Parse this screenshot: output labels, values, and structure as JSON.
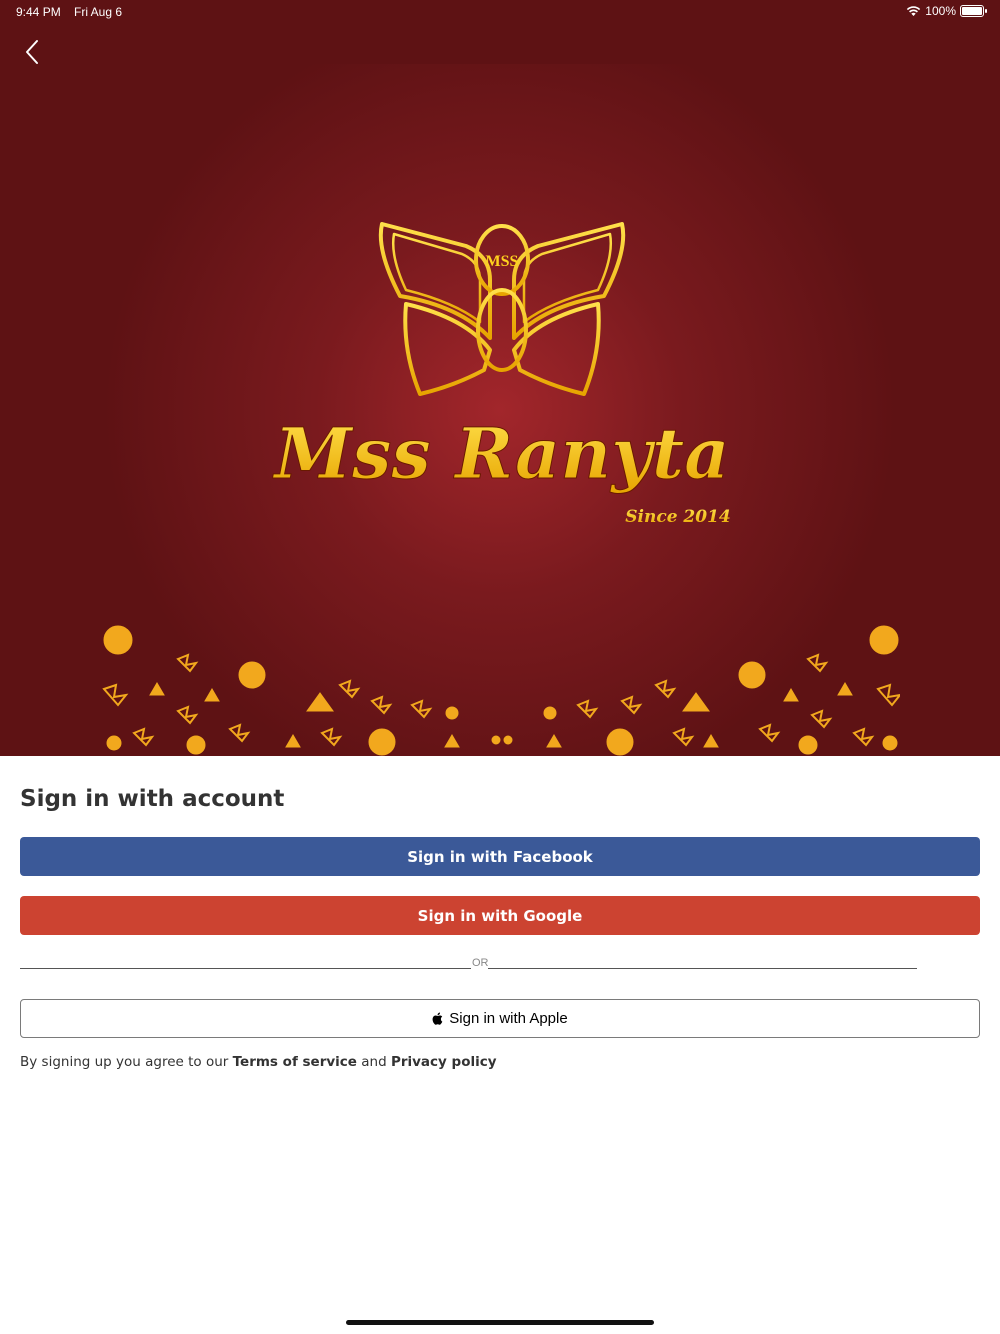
{
  "status_bar": {
    "time": "9:44 PM",
    "date": "Fri Aug 6",
    "battery": "100%",
    "wifi_icon": "wifi-icon",
    "battery_icon": "battery-icon"
  },
  "nav": {
    "back_icon": "chevron-left-icon"
  },
  "brand": {
    "monogram": "MSS",
    "name": "Mss Ranyta",
    "tagline": "Since 2014",
    "colors": {
      "background": "#5e1214",
      "gold": "#f4c21a"
    }
  },
  "signin": {
    "heading": "Sign in with account",
    "facebook_label": "Sign in with Facebook",
    "google_label": "Sign in with Google",
    "or_label": "OR",
    "apple_label": "Sign in with Apple",
    "apple_icon": "apple-icon",
    "legal_prefix": "By signing up you agree to our ",
    "terms_label": "Terms of service",
    "legal_and": " and ",
    "privacy_label": "Privacy policy",
    "colors": {
      "facebook": "#3b5998",
      "google": "#cc4331"
    }
  }
}
